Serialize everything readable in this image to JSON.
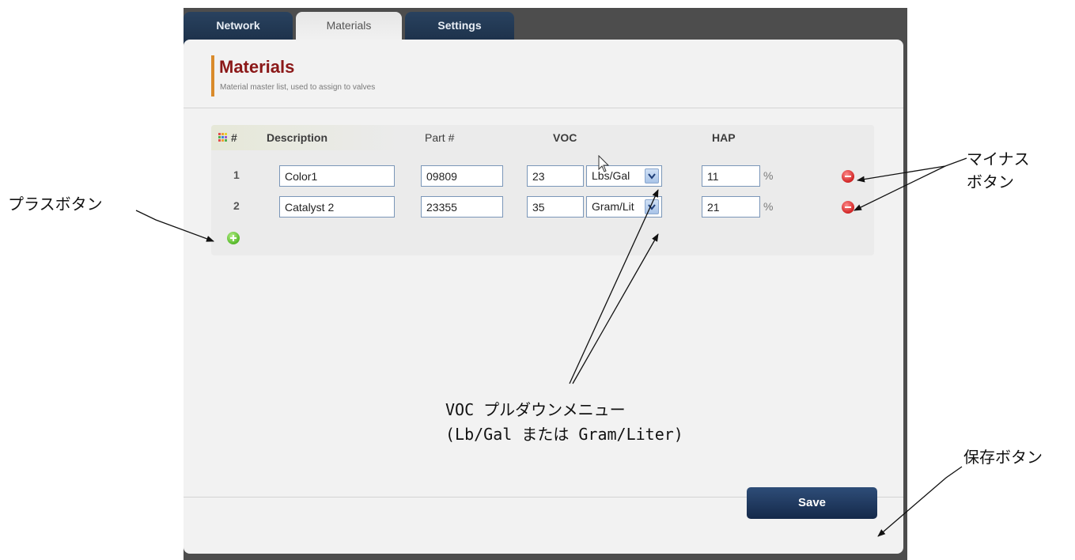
{
  "tabs": [
    {
      "label": "Network"
    },
    {
      "label": "Materials"
    },
    {
      "label": "Settings"
    }
  ],
  "header": {
    "title": "Materials",
    "subtitle": "Material master list, used to assign to valves"
  },
  "table": {
    "columns": [
      "#",
      "Description",
      "Part #",
      "VOC",
      "HAP"
    ],
    "rows": [
      {
        "num": "1",
        "description": "Color1",
        "part": "09809",
        "voc": "23",
        "voc_unit": "Lbs/Gal",
        "hap": "11",
        "hap_unit": "%"
      },
      {
        "num": "2",
        "description": "Catalyst 2",
        "part": "23355",
        "voc": "35",
        "voc_unit": "Gram/Lit",
        "hap": "21",
        "hap_unit": "%"
      }
    ]
  },
  "save_label": "Save",
  "annotations": {
    "plus_button": "プラスボタン",
    "minus_button_line1": "マイナス",
    "minus_button_line2": "ボタン",
    "voc_menu_line1": "VOC プルダウンメニュー",
    "voc_menu_line2": "(Lb/Gal または Gram/Liter)",
    "save_button": "保存ボタン"
  },
  "colors": {
    "title": "#8b1818",
    "accent_bar": "#d98b2b",
    "tab_dark": "#1c3049",
    "save_button": "#15294a"
  }
}
